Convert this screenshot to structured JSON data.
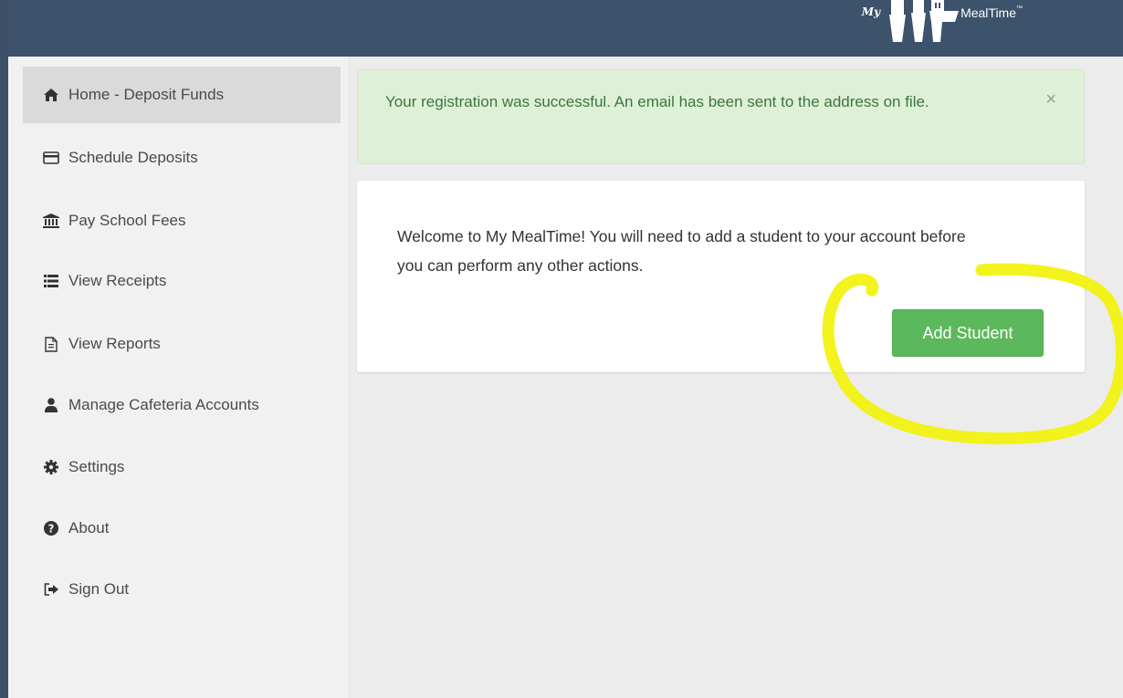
{
  "brand": {
    "prefix": "My",
    "name": "MealTime",
    "trademark": "™",
    "header_color": "#3d526b"
  },
  "sidebar": {
    "items": [
      {
        "label": "Home - Deposit Funds",
        "icon": "home-icon",
        "active": true
      },
      {
        "label": "Schedule Deposits",
        "icon": "credit-card-icon",
        "active": false
      },
      {
        "label": "Pay School Fees",
        "icon": "bank-icon",
        "active": false
      },
      {
        "label": "View Receipts",
        "icon": "list-icon",
        "active": false
      },
      {
        "label": "View Reports",
        "icon": "document-icon",
        "active": false
      },
      {
        "label": "Manage Cafeteria Accounts",
        "icon": "user-icon",
        "active": false
      },
      {
        "label": "Settings",
        "icon": "gear-icon",
        "active": false
      },
      {
        "label": "About",
        "icon": "question-icon",
        "active": false
      },
      {
        "label": "Sign Out",
        "icon": "sign-out-icon",
        "active": false
      }
    ]
  },
  "alert": {
    "message": "Your registration was successful. An email has been sent to the address on file.",
    "close_symbol": "×",
    "color": "#dff0d8"
  },
  "welcome": {
    "message": "Welcome to My MealTime! You will need to add a student to your account before you can perform any other actions.",
    "button_label": "Add Student",
    "button_color": "#5cb85c"
  },
  "annotation": {
    "shape": "hand-drawn yellow circle around Add Student button",
    "color": "#f2f20a"
  }
}
